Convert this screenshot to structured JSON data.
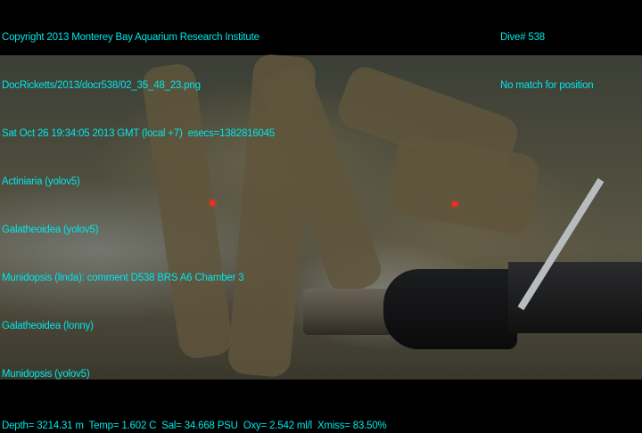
{
  "header_lines": [
    "Copyright 2013 Monterey Bay Aquarium Research Institute",
    "DocRicketts/2013/docr538/02_35_48_23.png",
    "Sat Oct 26 19:34:05 2013 GMT (local +7)  esecs=1382816045",
    "Actiniaria (yolov5)",
    "Galatheoidea (yolov5)",
    "Munidopsis (linda): comment D538 BRS A6 Chamber 3",
    "Galatheoidea (lonny)",
    "Munidopsis (yolov5)"
  ],
  "dive": "Dive# 538",
  "position": "No match for position",
  "footer": "Depth= 3214.31 m  Temp= 1.602 C  Sal= 34.668 PSU  Oxy= 2.542 ml/l  Xmiss= 83.50%",
  "colors": {
    "overlay_text": "#00e8e8",
    "laser": "#ff2a1a"
  }
}
